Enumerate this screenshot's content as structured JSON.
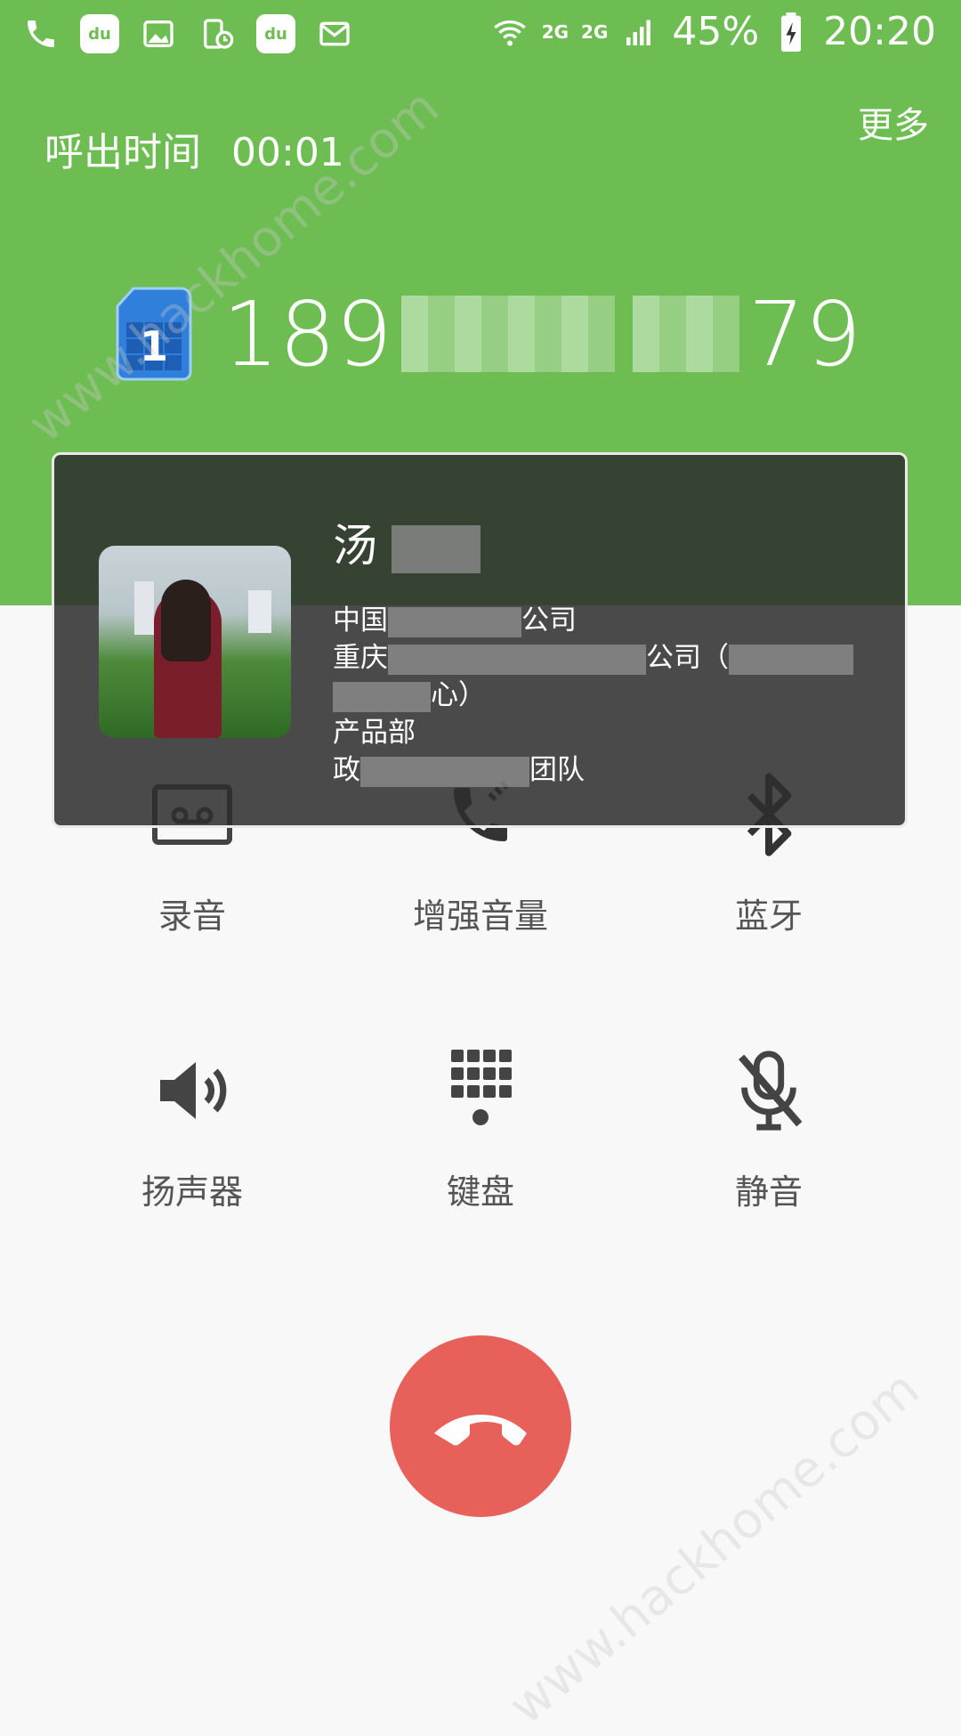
{
  "status_bar": {
    "left_icons": [
      "phone-icon",
      "du-map-pin-icon",
      "image-icon",
      "device-clock-icon",
      "du-map-pin-icon",
      "mail-icon"
    ],
    "network_2g_a": "2G",
    "network_2g_b": "2G",
    "battery": "45%",
    "time": "20:20"
  },
  "call": {
    "time_label": "呼出时间",
    "time_value": "00:01",
    "more": "更多",
    "sim_number": "1",
    "number_prefix": "189",
    "number_suffix": "79"
  },
  "contact": {
    "name": "汤",
    "line1_a": "中国",
    "line1_b": "公司",
    "line2_a": "重庆",
    "line2_b": "公司（",
    "line3_b": "心）",
    "line4": "产品部",
    "line5_a": "政",
    "line5_b": "团队"
  },
  "actions": {
    "record": "录音",
    "boost": "增强音量",
    "bluetooth": "蓝牙",
    "speaker": "扬声器",
    "keypad": "键盘",
    "mute": "静音"
  },
  "colors": {
    "header_green": "#6dbd53",
    "end_call_red": "#e8605a",
    "icon_gray": "#444444",
    "label_gray": "#555555"
  },
  "watermark": "www.hackhome.com"
}
